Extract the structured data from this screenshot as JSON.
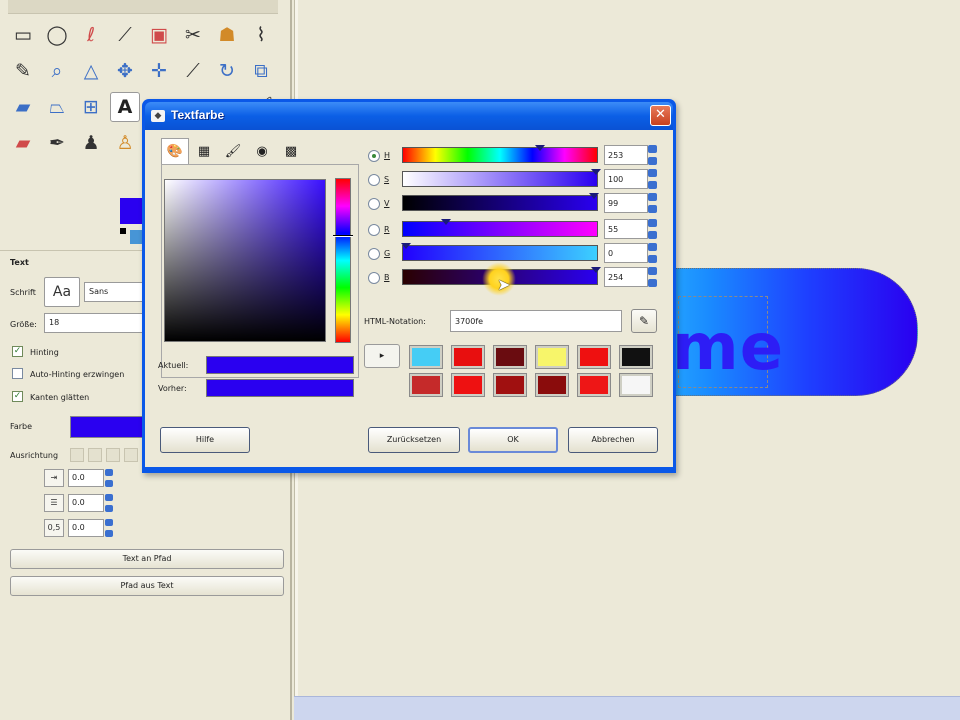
{
  "toolbox": {
    "tools": [
      "rect-select-icon",
      "ellipse-select-icon",
      "lasso-icon",
      "fuzzy-select-icon",
      "color-select-icon",
      "scissors-icon",
      "foreground-select-icon",
      "paths-icon",
      "color-picker-icon",
      "zoom-icon",
      "measure-icon",
      "move-icon",
      "align-icon",
      "crop-icon",
      "rotate-icon",
      "scale-icon",
      "shear-icon",
      "perspective-icon",
      "flip-icon",
      "text-icon",
      "bucket-fill-icon",
      "blend-icon",
      "pencil-icon",
      "paintbrush-icon",
      "eraser-icon",
      "airbrush-icon",
      "ink-icon",
      "clone-icon",
      "heal-icon",
      "dodge-icon",
      "smudge-icon",
      "blur-icon"
    ],
    "fg_color": "#2a00f0"
  },
  "tool_options": {
    "section_title": "Text",
    "font_label": "Schrift",
    "font_icon": "Aa",
    "font_value": "Sans",
    "size_label": "Größe:",
    "size_value": "18",
    "hinting_label": "Hinting",
    "autohint_label": "Auto-Hinting erzwingen",
    "antialias_label": "Kanten glätten",
    "color_label": "Farbe",
    "justify_label": "Ausrichtung",
    "indent_value": "0.0",
    "line_spacing_value": "0.0",
    "letter_spacing_value": "0.0",
    "letter_icon": "0,5",
    "text_along_path": "Text an Pfad",
    "path_from_text": "Pfad aus Text"
  },
  "canvas": {
    "button_text": "me"
  },
  "dialog": {
    "title": "Textfarbe",
    "close": "✕",
    "tabs": [
      "gimp-selector-icon",
      "cmyk-icon",
      "watercolor-icon",
      "color-wheel-icon",
      "palette-icon"
    ],
    "current_label": "Aktuell:",
    "previous_label": "Vorher:",
    "current_color": "#2a00f0",
    "previous_color": "#2a00f0",
    "channels": [
      {
        "label": "H",
        "value": "253",
        "selected": true
      },
      {
        "label": "S",
        "value": "100",
        "selected": false
      },
      {
        "label": "V",
        "value": "99",
        "selected": false
      },
      {
        "label": "R",
        "value": "55",
        "selected": false
      },
      {
        "label": "G",
        "value": "0",
        "selected": false
      },
      {
        "label": "B",
        "value": "254",
        "selected": false
      }
    ],
    "html_label": "HTML-Notation:",
    "html_value": "3700fe",
    "history_arrow": "▸",
    "history_colors": [
      "#45cdf5",
      "#e80f0f",
      "#6a0c10",
      "#f7f56a",
      "#ef1010",
      "#111111",
      "#c52a2a",
      "#ee1111",
      "#a01010",
      "#8a0c0c",
      "#ee1616",
      "#f6f6f6"
    ],
    "buttons": {
      "help": "Hilfe",
      "reset": "Zurücksetzen",
      "ok": "OK",
      "cancel": "Abbrechen"
    }
  }
}
